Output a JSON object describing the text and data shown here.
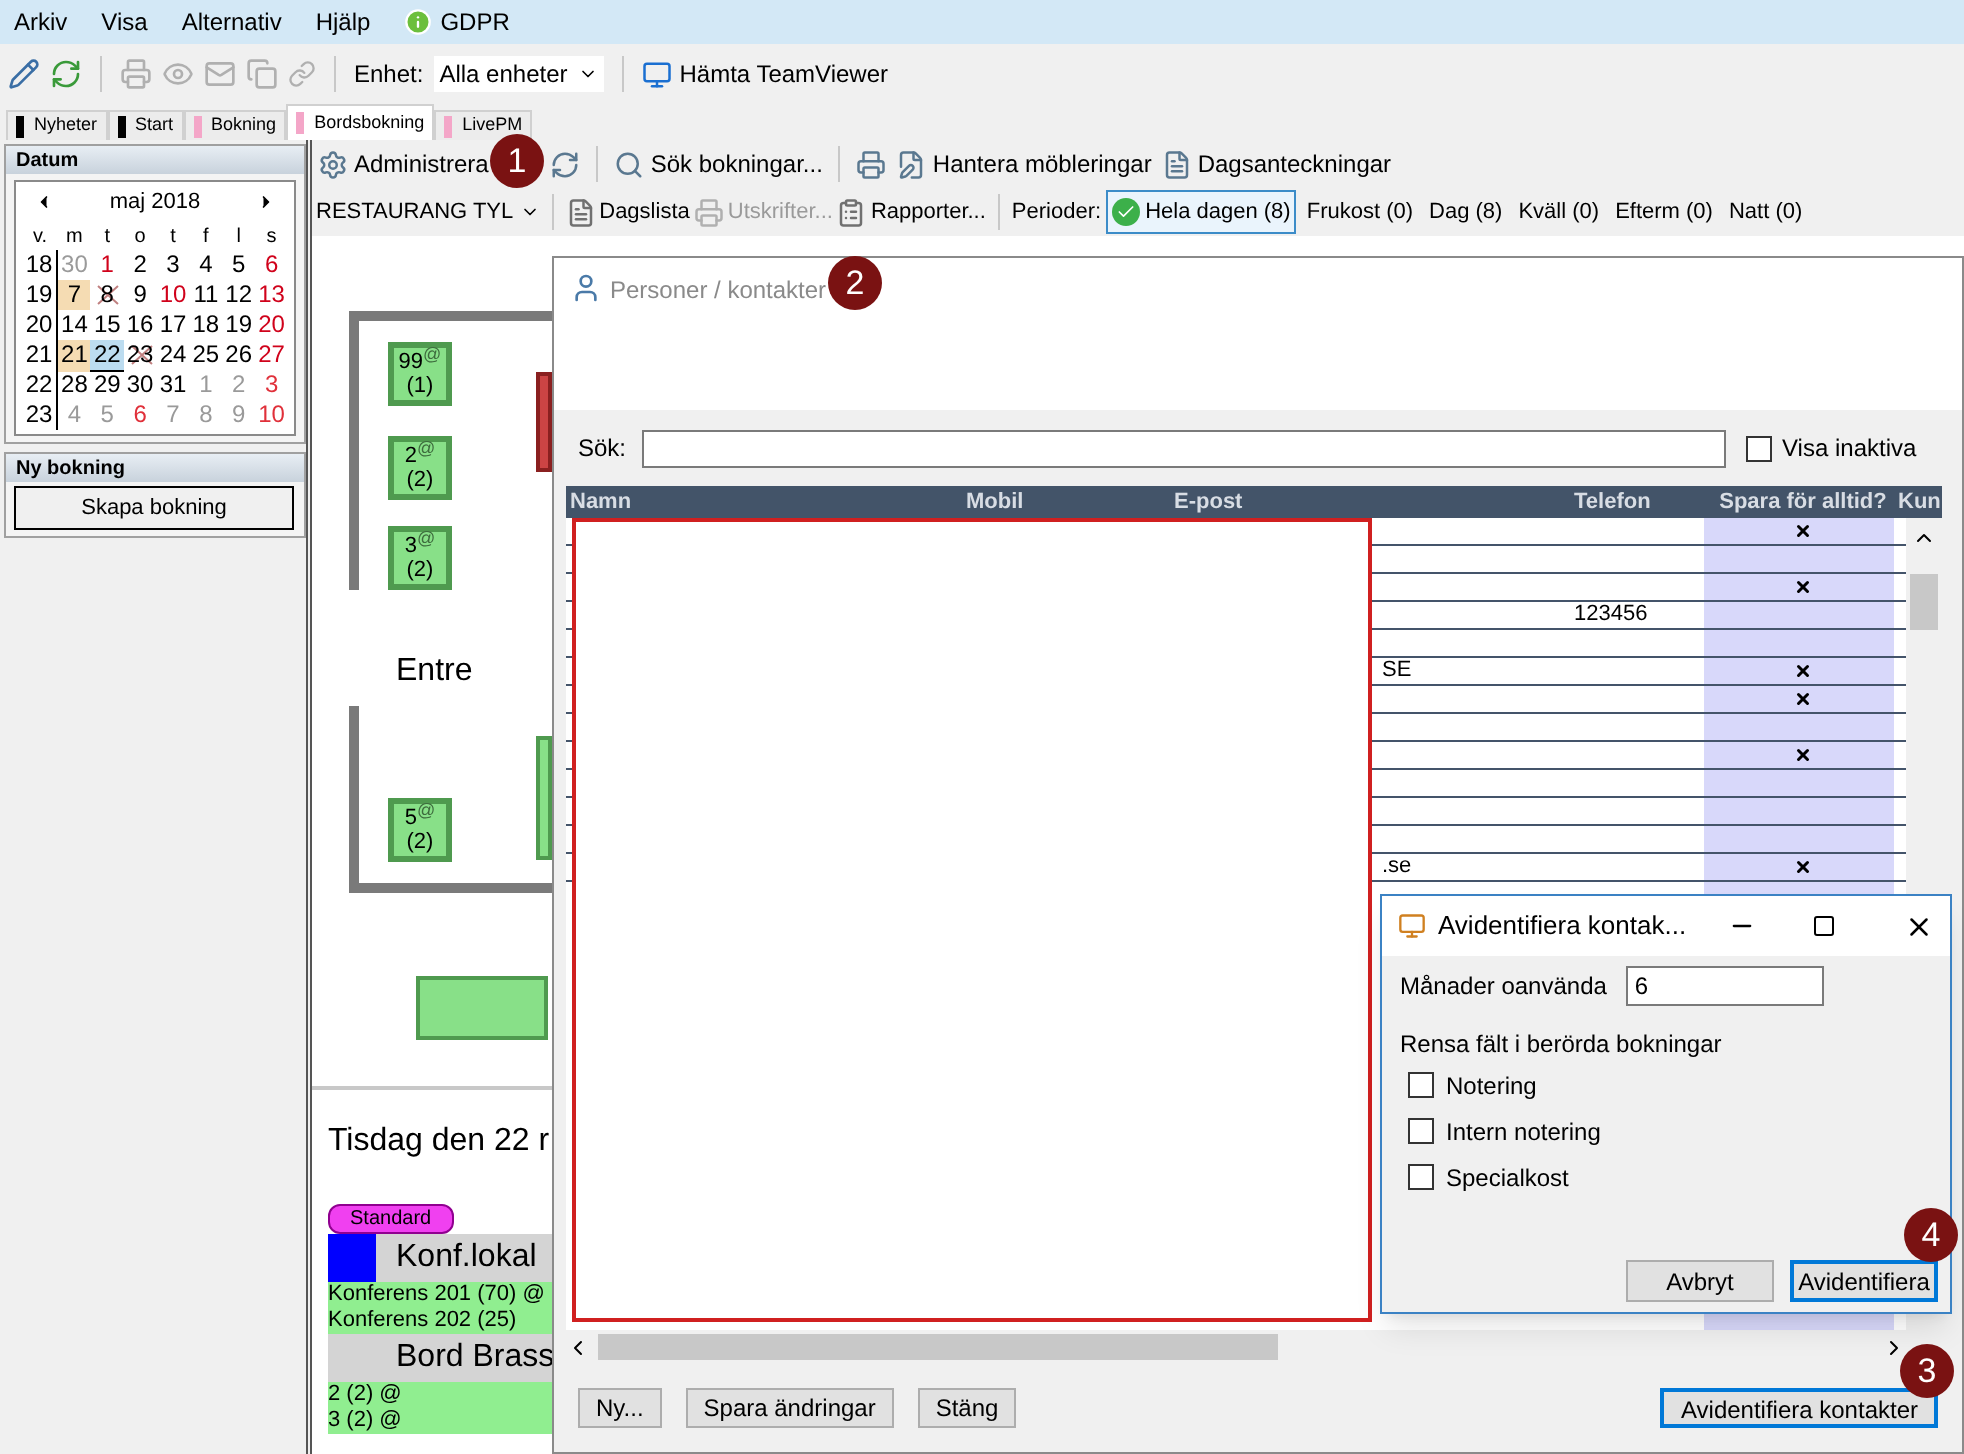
{
  "menu": [
    {
      "label": "Arkiv",
      "kind": "plain"
    },
    {
      "label": "Visa",
      "kind": "plain"
    },
    {
      "label": "Alternativ",
      "kind": "plain"
    },
    {
      "label": "Hjälp",
      "kind": "plain"
    },
    {
      "label": "GDPR",
      "kind": "info"
    }
  ],
  "toolbar": {
    "unit_label": "Enhet:",
    "unit_value": "Alla enheter",
    "teamviewer": "Hämta TeamViewer"
  },
  "tabs": [
    {
      "label": "Nyheter",
      "color": "#000000",
      "selected": false
    },
    {
      "label": "Start",
      "color": "#000000",
      "selected": false
    },
    {
      "label": "Bokning",
      "color": "#f4a6c8",
      "selected": false
    },
    {
      "label": "Bordsbokning",
      "color": "#f4a6c8",
      "selected": true
    },
    {
      "label": "LivePM",
      "color": "#f4a6c8",
      "selected": false
    }
  ],
  "sidebar": {
    "date_panel": {
      "title": "Datum",
      "month": "maj 2018",
      "weekdays": [
        "v.",
        "m",
        "t",
        "o",
        "t",
        "f",
        "l",
        "s"
      ],
      "weeks": [
        {
          "week": "18",
          "days": [
            {
              "day": "30",
              "other_month": true,
              "holiday": false,
              "highlighted": false,
              "selected": false,
              "crossed": false
            },
            {
              "day": "1",
              "other_month": false,
              "holiday": true,
              "highlighted": false,
              "selected": false,
              "crossed": false
            },
            {
              "day": "2",
              "other_month": false,
              "holiday": false,
              "highlighted": false,
              "selected": false,
              "crossed": false
            },
            {
              "day": "3",
              "other_month": false,
              "holiday": false,
              "highlighted": false,
              "selected": false,
              "crossed": false
            },
            {
              "day": "4",
              "other_month": false,
              "holiday": false,
              "highlighted": false,
              "selected": false,
              "crossed": false
            },
            {
              "day": "5",
              "other_month": false,
              "holiday": false,
              "highlighted": false,
              "selected": false,
              "crossed": false
            },
            {
              "day": "6",
              "other_month": false,
              "holiday": true,
              "highlighted": false,
              "selected": false,
              "crossed": false
            }
          ]
        },
        {
          "week": "19",
          "days": [
            {
              "day": "7",
              "other_month": false,
              "holiday": false,
              "highlighted": true,
              "selected": false,
              "crossed": false
            },
            {
              "day": "8",
              "other_month": false,
              "holiday": false,
              "highlighted": false,
              "selected": false,
              "crossed": true
            },
            {
              "day": "9",
              "other_month": false,
              "holiday": false,
              "highlighted": false,
              "selected": false,
              "crossed": false
            },
            {
              "day": "10",
              "other_month": false,
              "holiday": true,
              "highlighted": false,
              "selected": false,
              "crossed": false
            },
            {
              "day": "11",
              "other_month": false,
              "holiday": false,
              "highlighted": false,
              "selected": false,
              "crossed": false
            },
            {
              "day": "12",
              "other_month": false,
              "holiday": false,
              "highlighted": false,
              "selected": false,
              "crossed": false
            },
            {
              "day": "13",
              "other_month": false,
              "holiday": true,
              "highlighted": false,
              "selected": false,
              "crossed": false
            }
          ]
        },
        {
          "week": "20",
          "days": [
            {
              "day": "14",
              "other_month": false,
              "holiday": false,
              "highlighted": false,
              "selected": false,
              "crossed": false
            },
            {
              "day": "15",
              "other_month": false,
              "holiday": false,
              "highlighted": false,
              "selected": false,
              "crossed": false
            },
            {
              "day": "16",
              "other_month": false,
              "holiday": false,
              "highlighted": false,
              "selected": false,
              "crossed": false
            },
            {
              "day": "17",
              "other_month": false,
              "holiday": false,
              "highlighted": false,
              "selected": false,
              "crossed": false
            },
            {
              "day": "18",
              "other_month": false,
              "holiday": false,
              "highlighted": false,
              "selected": false,
              "crossed": false
            },
            {
              "day": "19",
              "other_month": false,
              "holiday": false,
              "highlighted": false,
              "selected": false,
              "crossed": false
            },
            {
              "day": "20",
              "other_month": false,
              "holiday": true,
              "highlighted": false,
              "selected": false,
              "crossed": false
            }
          ]
        },
        {
          "week": "21",
          "days": [
            {
              "day": "21",
              "other_month": false,
              "holiday": false,
              "highlighted": true,
              "selected": false,
              "crossed": false
            },
            {
              "day": "22",
              "other_month": false,
              "holiday": false,
              "highlighted": false,
              "selected": true,
              "crossed": false
            },
            {
              "day": "23",
              "other_month": false,
              "holiday": false,
              "highlighted": false,
              "selected": false,
              "crossed": true
            },
            {
              "day": "24",
              "other_month": false,
              "holiday": false,
              "highlighted": false,
              "selected": false,
              "crossed": false
            },
            {
              "day": "25",
              "other_month": false,
              "holiday": false,
              "highlighted": false,
              "selected": false,
              "crossed": false
            },
            {
              "day": "26",
              "other_month": false,
              "holiday": false,
              "highlighted": false,
              "selected": false,
              "crossed": false
            },
            {
              "day": "27",
              "other_month": false,
              "holiday": true,
              "highlighted": false,
              "selected": false,
              "crossed": false
            }
          ]
        },
        {
          "week": "22",
          "days": [
            {
              "day": "28",
              "other_month": false,
              "holiday": false,
              "highlighted": false,
              "selected": false,
              "crossed": false
            },
            {
              "day": "29",
              "other_month": false,
              "holiday": false,
              "highlighted": false,
              "selected": false,
              "crossed": false
            },
            {
              "day": "30",
              "other_month": false,
              "holiday": false,
              "highlighted": false,
              "selected": false,
              "crossed": false
            },
            {
              "day": "31",
              "other_month": false,
              "holiday": false,
              "highlighted": false,
              "selected": false,
              "crossed": false
            },
            {
              "day": "1",
              "other_month": true,
              "holiday": false,
              "highlighted": false,
              "selected": false,
              "crossed": false
            },
            {
              "day": "2",
              "other_month": true,
              "holiday": false,
              "highlighted": false,
              "selected": false,
              "crossed": false
            },
            {
              "day": "3",
              "other_month": true,
              "holiday": true,
              "highlighted": false,
              "selected": false,
              "crossed": false
            }
          ]
        },
        {
          "week": "23",
          "days": [
            {
              "day": "4",
              "other_month": true,
              "holiday": false,
              "highlighted": false,
              "selected": false,
              "crossed": false
            },
            {
              "day": "5",
              "other_month": true,
              "holiday": false,
              "highlighted": false,
              "selected": false,
              "crossed": false
            },
            {
              "day": "6",
              "other_month": true,
              "holiday": true,
              "highlighted": false,
              "selected": false,
              "crossed": false
            },
            {
              "day": "7",
              "other_month": true,
              "holiday": false,
              "highlighted": false,
              "selected": false,
              "crossed": false
            },
            {
              "day": "8",
              "other_month": true,
              "holiday": false,
              "highlighted": false,
              "selected": false,
              "crossed": false
            },
            {
              "day": "9",
              "other_month": true,
              "holiday": false,
              "highlighted": false,
              "selected": false,
              "crossed": false
            },
            {
              "day": "10",
              "other_month": true,
              "holiday": true,
              "highlighted": false,
              "selected": false,
              "crossed": false
            }
          ]
        }
      ]
    },
    "new_booking": {
      "title": "Ny bokning",
      "button": "Skapa bokning"
    }
  },
  "main_toolbar": [
    {
      "kind": "gear",
      "label": "Administrera"
    },
    {
      "kind": "refresh"
    },
    {
      "kind": "search",
      "label": "Sök bokningar..."
    },
    {
      "kind": "print"
    },
    {
      "kind": "edit",
      "label": "Hantera möbleringar"
    },
    {
      "kind": "notes",
      "label": "Dagsanteckningar"
    }
  ],
  "restaurant": "RESTAURANG TYL",
  "secondary_toolbar": [
    {
      "kind": "list",
      "label": "Dagslista",
      "disabled": false
    },
    {
      "kind": "print",
      "label": "Utskrifter...",
      "disabled": true
    },
    {
      "kind": "report",
      "label": "Rapporter...",
      "disabled": false
    }
  ],
  "periods_label": "Perioder:",
  "periods": [
    {
      "label": "Hela dagen (8)",
      "selected": true
    },
    {
      "label": "Frukost (0)",
      "selected": false
    },
    {
      "label": "Dag (8)",
      "selected": false
    },
    {
      "label": "Kväll (0)",
      "selected": false
    },
    {
      "label": "Efterm (0)",
      "selected": false
    },
    {
      "label": "Natt (0)",
      "selected": false
    }
  ],
  "floor_plan": {
    "entrance": "Entre",
    "tables": [
      {
        "number": "99",
        "mark": "@",
        "guests": "(1)"
      },
      {
        "number": "2",
        "mark": "@",
        "guests": "(2)"
      },
      {
        "number": "3",
        "mark": "@",
        "guests": "(2)"
      },
      {
        "number": "5",
        "mark": "@",
        "guests": "(2)"
      }
    ]
  },
  "day_view": {
    "title": "Tisdag den 22 r",
    "tag": "Standard",
    "groups": [
      {
        "name": "Konf.lokal",
        "color": "#0000ff",
        "items": [
          "Konferens 201 (70) @",
          "Konferens 202 (25)"
        ]
      },
      {
        "name": "Bord Brass",
        "items": [
          "2 (2) @",
          "3 (2) @"
        ]
      }
    ]
  },
  "contacts_dialog": {
    "title": "Personer / kontakter",
    "search_label": "Sök:",
    "show_inactive": {
      "label": "Visa inaktiva",
      "checked": false
    },
    "columns": [
      "Namn",
      "Mobil",
      "E-post",
      "Telefon",
      "Spara för alltid?",
      "Kun"
    ],
    "rows": [
      {
        "saved": true
      },
      {
        "saved": false
      },
      {
        "saved": true
      },
      {
        "phone": "123456",
        "saved": false
      },
      {
        "saved": false
      },
      {
        "email": "SE",
        "saved": true
      },
      {
        "saved": true
      },
      {
        "saved": false
      },
      {
        "saved": true
      },
      {
        "saved": false
      },
      {
        "saved": false
      },
      {
        "saved": false
      },
      {
        "email": ".se",
        "saved": true
      }
    ],
    "buttons": [
      {
        "label": "Ny...",
        "kind": "left",
        "focused": false
      },
      {
        "label": "Spara ändringar",
        "kind": "left",
        "focused": false
      },
      {
        "label": "Stäng",
        "kind": "left",
        "focused": false
      },
      {
        "label": "Avidentifiera kontakter",
        "kind": "right",
        "focused": true
      }
    ]
  },
  "anonymize_dialog": {
    "title": "Avidentifiera kontak...",
    "months_label": "Månader oanvända",
    "months_value": "6",
    "clear_label": "Rensa fält i berörda bokningar",
    "options": [
      {
        "label": "Notering",
        "checked": false
      },
      {
        "label": "Intern notering",
        "checked": false
      },
      {
        "label": "Specialkost",
        "checked": false
      }
    ],
    "buttons": [
      {
        "label": "Avbryt",
        "focused": false
      },
      {
        "label": "Avidentifiera",
        "focused": true
      }
    ]
  },
  "callouts": [
    "1",
    "2",
    "3",
    "4"
  ]
}
